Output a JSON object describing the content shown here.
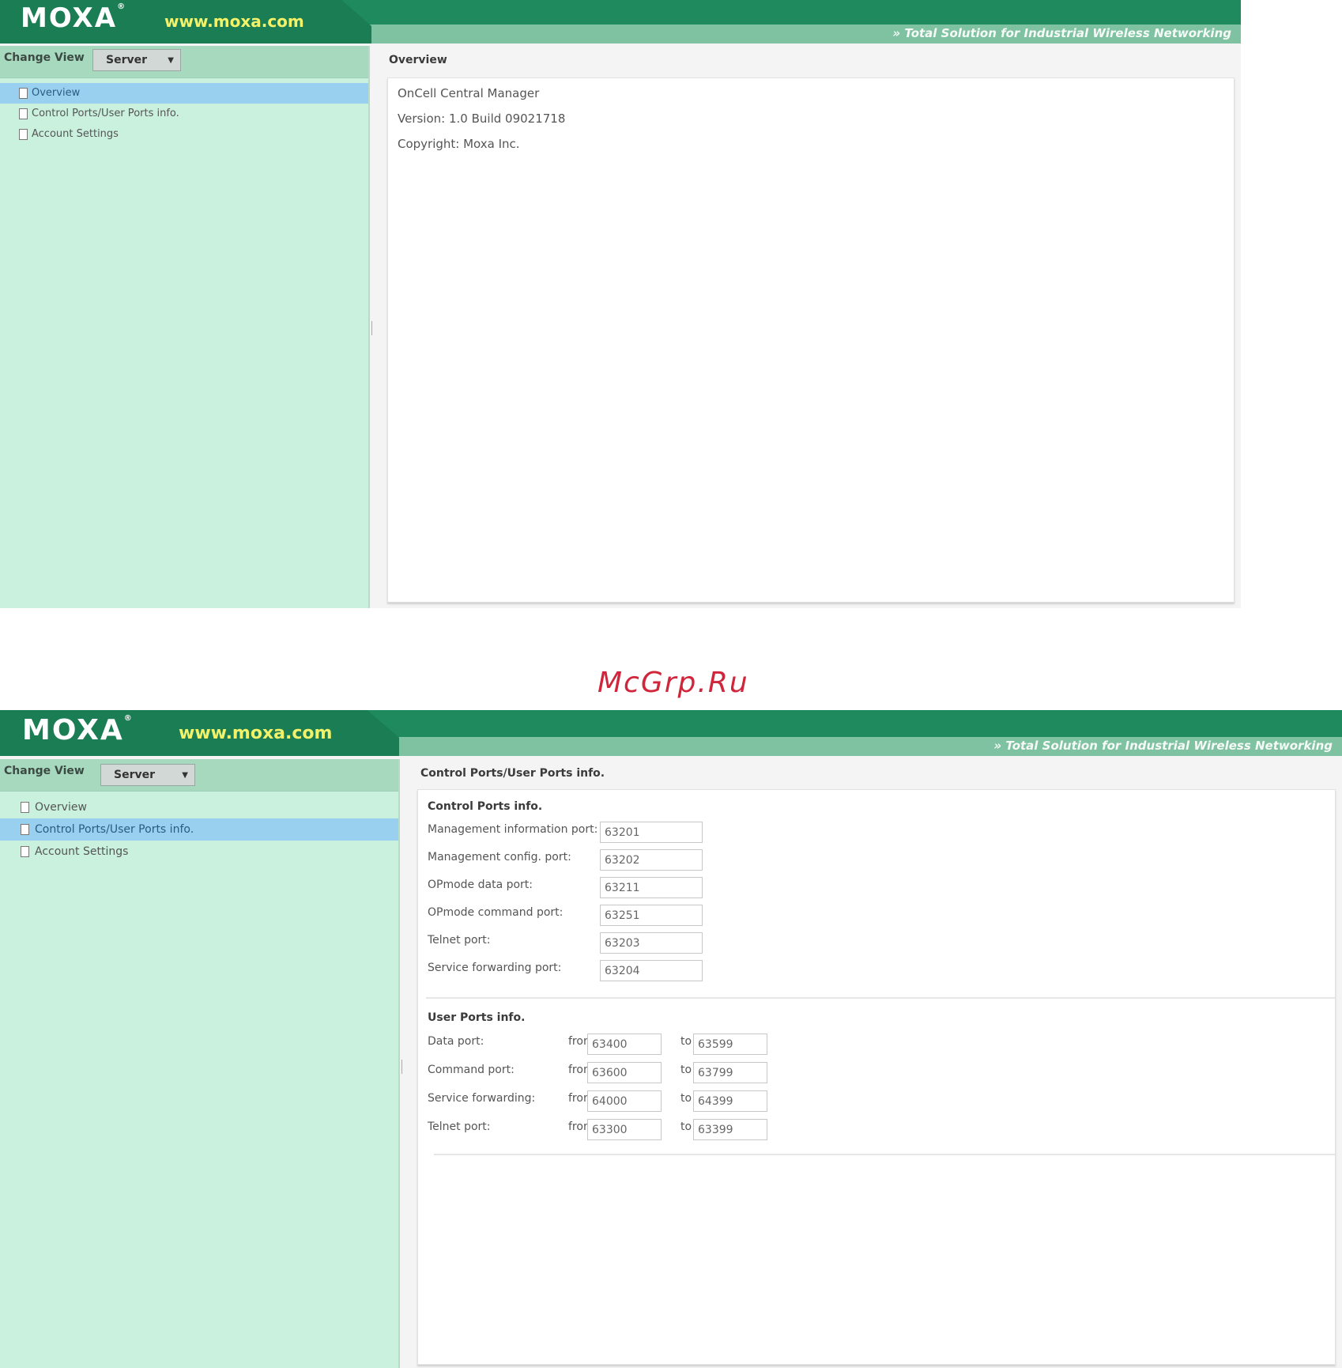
{
  "header": {
    "logo": "MOXA",
    "logo_mark": "®",
    "site": "www.moxa.com",
    "slogan": "» Total Solution for Industrial Wireless Networking"
  },
  "sidebar": {
    "change_view_label": "Change View",
    "view_select": "Server",
    "items": [
      {
        "label": "Overview"
      },
      {
        "label": "Control Ports/User Ports info."
      },
      {
        "label": "Account Settings"
      }
    ]
  },
  "overview": {
    "title": "Overview",
    "product": "OnCell Central Manager",
    "version": "Version: 1.0 Build 09021718",
    "copyright": "Copyright: Moxa Inc."
  },
  "ports": {
    "title": "Control Ports/User Ports info.",
    "control_title": "Control Ports info.",
    "control": [
      {
        "label": "Management information port:",
        "value": "63201"
      },
      {
        "label": "Management config. port:",
        "value": "63202"
      },
      {
        "label": "OPmode data port:",
        "value": "63211"
      },
      {
        "label": "OPmode command port:",
        "value": "63251"
      },
      {
        "label": "Telnet port:",
        "value": "63203"
      },
      {
        "label": "Service forwarding port:",
        "value": "63204"
      }
    ],
    "user_title": "User Ports info.",
    "from_label": "from",
    "to_label": "to",
    "user": [
      {
        "label": "Data port:",
        "from": "63400",
        "to": "63599"
      },
      {
        "label": "Command port:",
        "from": "63600",
        "to": "63799"
      },
      {
        "label": "Service forwarding:",
        "from": "64000",
        "to": "64399"
      },
      {
        "label": "Telnet port:",
        "from": "63300",
        "to": "63399"
      }
    ]
  },
  "watermark": "McGrp.Ru",
  "colors": {
    "header_green": "#1f8a5e",
    "sidebar_mint": "#c9f1de",
    "selected_blue": "#99d0f0",
    "site_yellow": "#f2f26a",
    "watermark_red": "#d0263b"
  }
}
